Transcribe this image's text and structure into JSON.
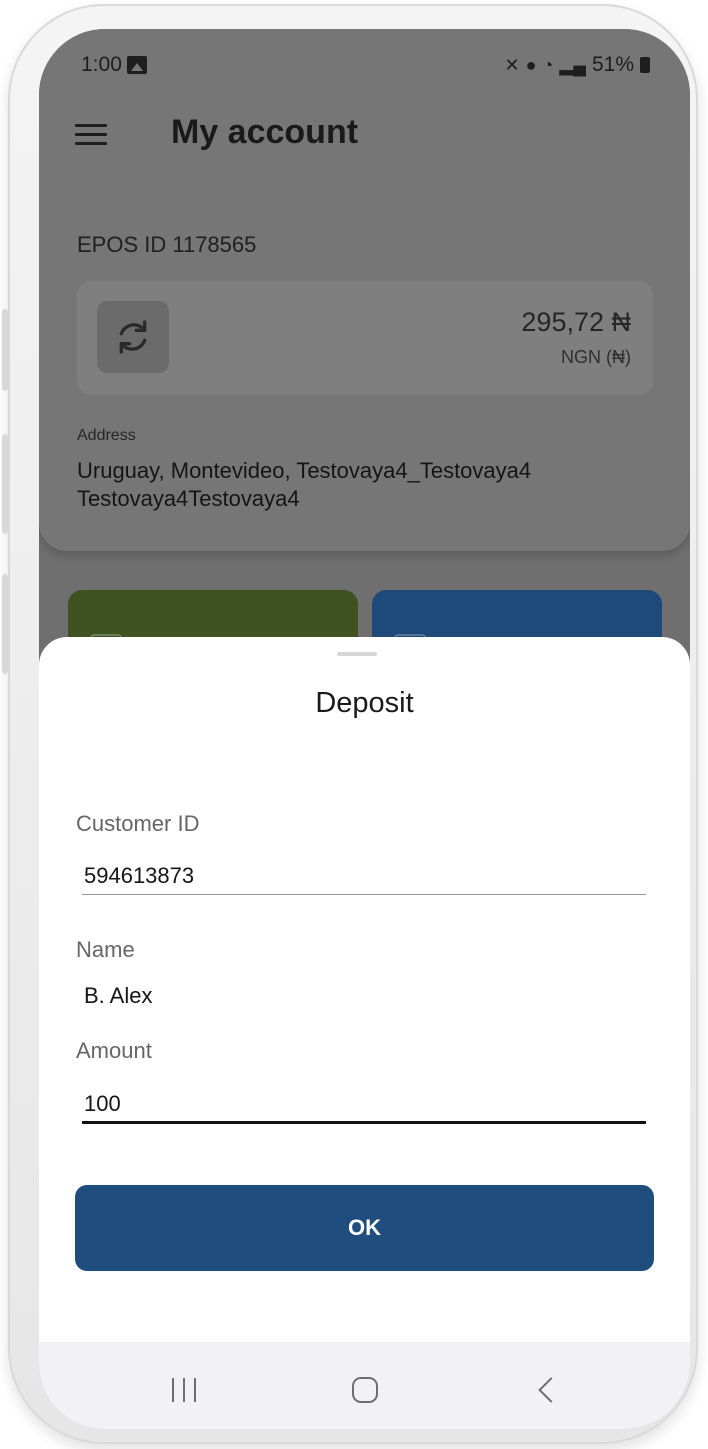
{
  "status_bar": {
    "time": "1:00",
    "battery": "51%",
    "icons": [
      "photo-icon",
      "mute-icon",
      "location-icon",
      "wifi-icon",
      "signal-icon",
      "battery-icon"
    ]
  },
  "header": {
    "title": "My account",
    "menu_icon": "menu-icon"
  },
  "account": {
    "epos_id": "EPOS ID 1178565",
    "balance": "295,72 ₦",
    "currency": "NGN (₦)",
    "refresh_icon": "refresh-icon",
    "address_label": "Address",
    "address_value": "Uruguay, Montevideo, Testovaya4_Testovaya4 Testovaya4Testovaya4"
  },
  "tiles": [
    {
      "color": "#3e5222"
    },
    {
      "color": "#1d4a79"
    }
  ],
  "deposit_sheet": {
    "title": "Deposit",
    "customer_id_label": "Customer ID",
    "customer_id_value": "594613873",
    "name_label": "Name",
    "name_value": "B. Alex",
    "amount_label": "Amount",
    "amount_value": "100",
    "ok_label": "OK"
  },
  "nav_bar": {
    "icons": [
      "recents-icon",
      "home-icon",
      "back-icon"
    ]
  },
  "colors": {
    "primary": "#1f4d7d",
    "green_tile": "#3e5222",
    "blue_tile": "#1d4a79",
    "scrim": "#6f6f6f"
  }
}
